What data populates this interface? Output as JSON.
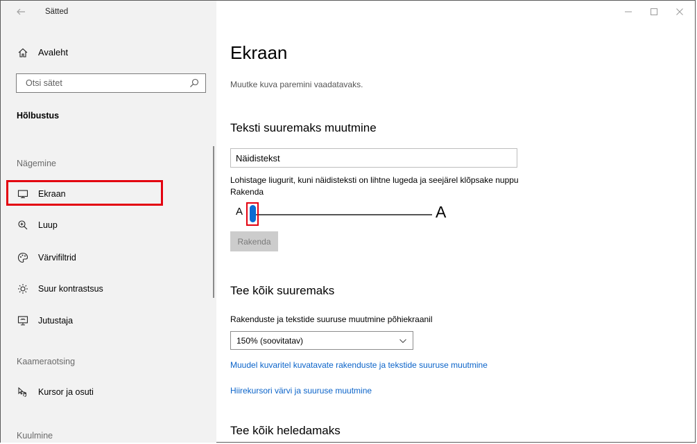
{
  "window": {
    "title": "Sätted",
    "minimize_glyph": "—",
    "maximize_glyph": "☐",
    "close_glyph": "✕"
  },
  "sidebar": {
    "home_label": "Avaleht",
    "search": {
      "placeholder": "Otsi sätet",
      "value": ""
    },
    "category": "Hõlbustus",
    "sections": {
      "vision": "Nägemine",
      "camera": "Kaameraotsing",
      "hearing": "Kuulmine"
    },
    "items": [
      {
        "label": "Ekraan",
        "icon": "monitor-icon",
        "selected": true
      },
      {
        "label": "Luup",
        "icon": "magnifier-icon"
      },
      {
        "label": "Värvifiltrid",
        "icon": "palette-icon"
      },
      {
        "label": "Suur kontrastsus",
        "icon": "contrast-sun-icon"
      },
      {
        "label": "Jutustaja",
        "icon": "narrator-icon"
      },
      {
        "label": "Kursor ja osuti",
        "icon": "cursor-pointer-icon"
      }
    ]
  },
  "main": {
    "title": "Ekraan",
    "subtitle": "Muutke kuva paremini vaadatavaks.",
    "text_size": {
      "heading": "Teksti suuremaks muutmine",
      "sample_text": "Näidistekst",
      "hint": "Lohistage liugurit, kuni näidisteksti on lihtne lugeda ja seejärel klõpsake nuppu Rakenda",
      "small_glyph": "A",
      "large_glyph": "A",
      "slider_level": 0,
      "apply_label": "Rakenda"
    },
    "scale": {
      "heading": "Tee kõik suuremaks",
      "label": "Rakenduste ja tekstide suuruse muutmine põhiekraanil",
      "selected": "150% (soovitatav)",
      "link_other_displays": "Muudel kuvaritel kuvatavate rakenduste ja tekstide suuruse muutmine",
      "link_cursor": "Hiirekursori värvi ja suuruse muutmine"
    },
    "brightness": {
      "heading": "Tee kõik heledamaks"
    }
  },
  "colors": {
    "accent": "#0a6cd3",
    "highlight_frame": "#e3000f",
    "link": "#0a63c9",
    "sidebar_bg": "#f2f2f2"
  }
}
